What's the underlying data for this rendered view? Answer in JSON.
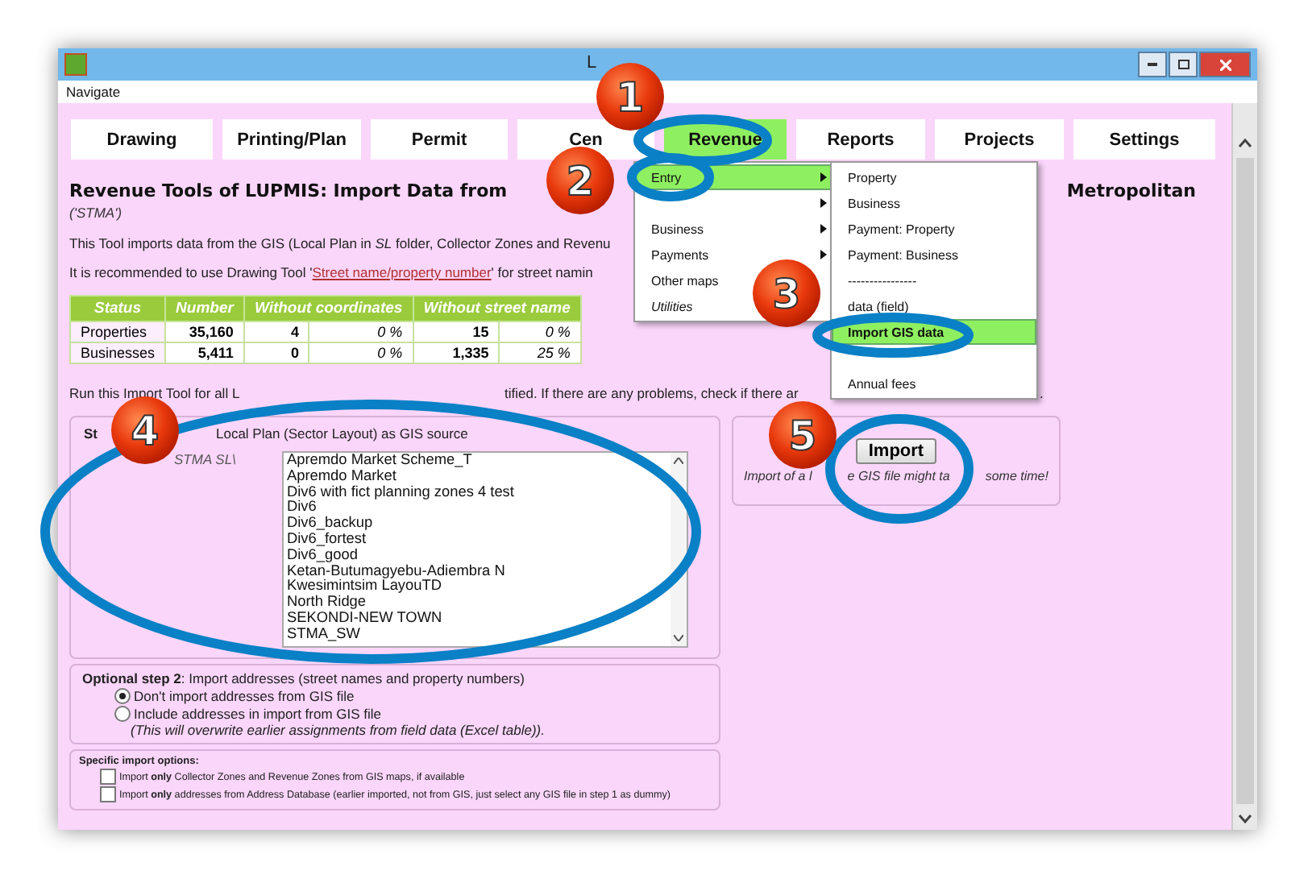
{
  "window": {
    "title": "L"
  },
  "menu_bar": [
    "Navigate"
  ],
  "tabs": [
    {
      "label": "Drawing",
      "selected": false
    },
    {
      "label": "Printing/Plan",
      "selected": false
    },
    {
      "label": "Permit",
      "selected": false
    },
    {
      "label": "Cen",
      "selected": false
    },
    {
      "label": "Revenue",
      "selected": true
    },
    {
      "label": "Reports",
      "selected": false
    },
    {
      "label": "Projects",
      "selected": false
    },
    {
      "label": "Settings",
      "selected": false
    }
  ],
  "heading": {
    "left": "Revenue Tools of LUPMIS: Import Data from",
    "right": "Metropolitan"
  },
  "subtitle": "('STMA')",
  "intro": "This Tool imports data from the GIS (Local Plan in *SL* folder, Collector Zones and Revenu",
  "recommendation": {
    "before": "It is recommended to use Drawing Tool '",
    "link": "Street name/property number",
    "after": "' for street namin"
  },
  "status_table": {
    "columns": [
      "Status",
      "Number",
      "Without coordinates",
      "Without street name"
    ],
    "rows": [
      {
        "status": "Properties",
        "number": "35,160",
        "without_coordinates": {
          "count": "4",
          "share": "0 %"
        },
        "without_street_name": {
          "count": "15",
          "share": "0 %"
        }
      },
      {
        "status": "Businesses",
        "number": "5,411",
        "without_coordinates": {
          "count": "0",
          "share": "0 %"
        },
        "without_street_name": {
          "count": "1,335",
          "share": "25 %"
        }
      }
    ]
  },
  "run_note": {
    "start": "Run this Import Tool for all L",
    "end": "tified. If there are any problems, check if there ar",
    "tail": "."
  },
  "step1": {
    "title_start": "St",
    "title_end": "Local Plan (Sector Layout) as GIS source",
    "path": "STMA SL\\",
    "files": [
      "Apremdo Market Scheme_T",
      "Apremdo Market",
      "Div6 with fict planning zones 4 test",
      "Div6",
      "Div6_backup",
      "Div6_fortest",
      "Div6_good",
      "Ketan-Butumagyebu-Adiembra N",
      "Kwesimintsim LayouTD",
      "North Ridge",
      "SEKONDI-NEW TOWN",
      "STMA_SW"
    ]
  },
  "step2": {
    "title": "**Optional step 2**: Import addresses (street names and property numbers)",
    "options": [
      {
        "label": "Don't import addresses from GIS file",
        "selected": true
      },
      {
        "label": "Include addresses in import from GIS file",
        "selected": false
      }
    ],
    "note": "(This will overwrite earlier assignments from field data (Excel table))."
  },
  "specific_options": {
    "title": "Specific import options:",
    "options": [
      {
        "label": "Import **only** Collector Zones and Revenue Zones from GIS maps, if available",
        "checked": false
      },
      {
        "label": "Import **only** addresses from Address Database (earlier imported, not from GIS, just select any GIS file in step 1 as dummy)",
        "checked": false
      }
    ]
  },
  "import_panel": {
    "button": "Import",
    "note_parts": [
      "Import of a l",
      "e GIS file might ta",
      "some time!"
    ]
  },
  "revenue_menu": [
    {
      "label": "Entry",
      "submenu": true,
      "selected": true
    },
    {
      "submenu": true,
      "selected": false
    },
    {
      "label": "Business",
      "submenu": true,
      "selected": false
    },
    {
      "label": "Payments",
      "submenu": true,
      "selected": false
    },
    {
      "label": "Other maps",
      "submenu": false,
      "selected": false
    },
    {
      "label": "Utilities",
      "submenu": false,
      "selected": false,
      "italic": true
    }
  ],
  "entry_submenu": [
    {
      "label": "Property",
      "selected": false
    },
    {
      "label": "Business",
      "selected": false
    },
    {
      "label": "Payment: Property",
      "selected": false
    },
    {
      "label": "Payment: Business",
      "selected": false
    },
    {
      "label": "----------------",
      "selected": false
    },
    {
      "label": "data (field)",
      "selected": false
    },
    {
      "label": "Import GIS data",
      "selected": true
    },
    {
      "label": "Annual fees",
      "selected": false
    }
  ],
  "callouts": [
    {
      "label": "1"
    },
    {
      "label": "2"
    },
    {
      "label": "3"
    },
    {
      "label": "4"
    },
    {
      "label": "5"
    }
  ]
}
